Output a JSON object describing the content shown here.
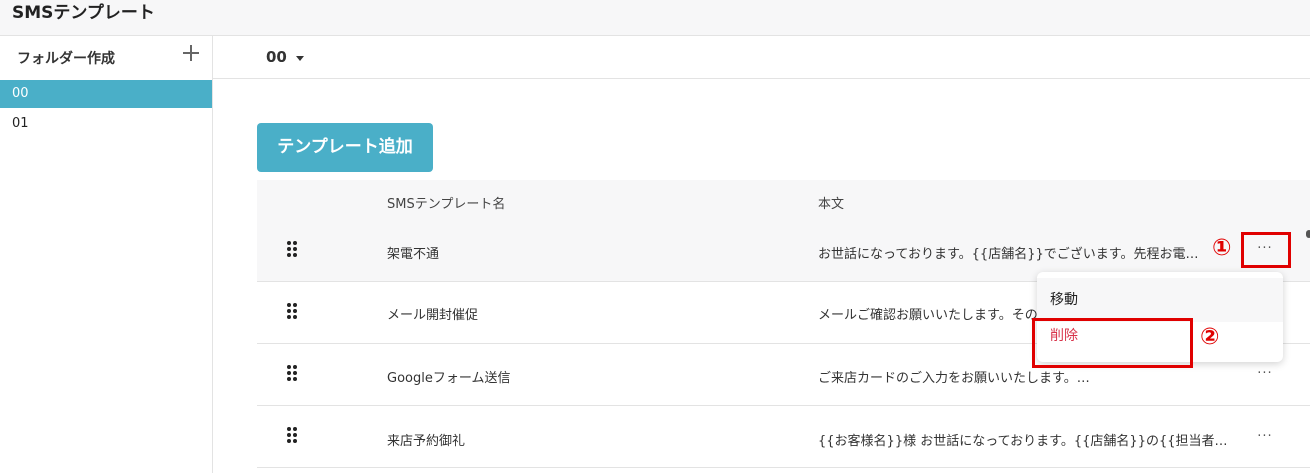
{
  "app": {
    "title": "SMSテンプレート"
  },
  "sidebar": {
    "create_folder_label": "フォルダー作成",
    "folders": [
      {
        "label": "00",
        "active": true
      },
      {
        "label": "01",
        "active": false
      }
    ]
  },
  "toolbar": {
    "folder_selected": "00"
  },
  "main": {
    "add_button_label": "テンプレート追加",
    "table": {
      "headers": {
        "name": "SMSテンプレート名",
        "body": "本文"
      },
      "rows": [
        {
          "name": "架電不通",
          "body": "お世話になっております。{{店舗名}}でございます。先程お電…",
          "more": "···"
        },
        {
          "name": "メール開封催促",
          "body": "メールご確認お願いいたします。その",
          "more": "···"
        },
        {
          "name": "Googleフォーム送信",
          "body": "ご来店カードのご入力をお願いいたします。…",
          "more": "···"
        },
        {
          "name": "来店予約御礼",
          "body": "{{お客様名}}様 お世話になっております。{{店舗名}}の{{担当者…",
          "more": "···"
        }
      ]
    }
  },
  "context_menu": {
    "move_label": "移動",
    "delete_label": "削除"
  },
  "annotations": {
    "step1": "①",
    "step2": "②"
  },
  "colors": {
    "accent": "#4aafc8",
    "danger": "#d8334a",
    "annotation": "#e00000"
  },
  "icons": {
    "add_folder": "plus-icon",
    "drag": "drag-handle-icon",
    "more": "more-icon",
    "dropdown": "caret-down-icon"
  }
}
